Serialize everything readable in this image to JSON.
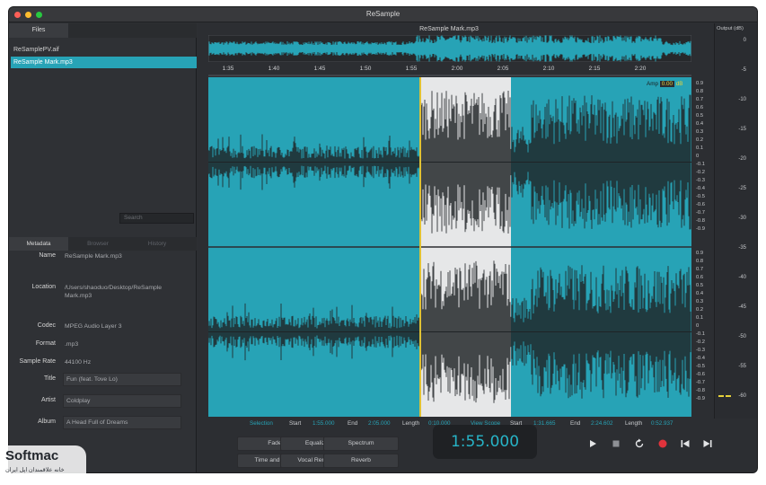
{
  "app": {
    "title": "ReSample"
  },
  "sidebar": {
    "files_tab": "Files",
    "files": [
      "ReSamplePV.aif",
      "ReSample Mark.mp3"
    ],
    "selected_index": 1,
    "search_placeholder": "Search",
    "tabs": [
      "Metadata",
      "Browser",
      "History"
    ],
    "active_tab": 0
  },
  "metadata": {
    "name_label": "Name",
    "name": "ReSample Mark.mp3",
    "location_label": "Location",
    "location": "/Users/shaoduo/Desktop/ReSample Mark.mp3",
    "codec_label": "Codec",
    "codec": "MPEG Audio Layer 3",
    "format_label": "Format",
    "format": ".mp3",
    "sample_rate_label": "Sample Rate",
    "sample_rate": "44100 Hz",
    "title_label": "Title",
    "title": "Fun (feat. Tove Lo)",
    "artist_label": "Artist",
    "artist": "Coldplay",
    "album_label": "Album",
    "album": "A Head Full of Dreams"
  },
  "editor": {
    "filename": "ReSample Mark.mp3",
    "timeline_ticks": [
      "1:35",
      "1:40",
      "1:45",
      "1:50",
      "1:55",
      "2:00",
      "2:05",
      "2:10",
      "2:15",
      "2:20"
    ],
    "amp_label": "Amp",
    "amp_value": "0.00",
    "amp_unit": "dB",
    "amp_scale": [
      "0.9",
      "0.8",
      "0.7",
      "0.6",
      "0.5",
      "0.4",
      "0.3",
      "0.2",
      "0.1",
      "0",
      "-0.1",
      "-0.2",
      "-0.3",
      "-0.4",
      "-0.5",
      "-0.6",
      "-0.7",
      "-0.8",
      "-0.9"
    ],
    "output_label": "Output (dB)",
    "db_scale": [
      "0",
      "-5",
      "-10",
      "-15",
      "-20",
      "-25",
      "-30",
      "-35",
      "-40",
      "-45",
      "-50",
      "-55",
      "-60"
    ],
    "selection": {
      "label": "Selection",
      "start_label": "Start",
      "start": "1:55.000",
      "end_label": "End",
      "end": "2:05.000",
      "length_label": "Length",
      "length": "0:10.000"
    },
    "view_scope": {
      "label": "View Scope",
      "start_label": "Start",
      "start": "1:31.665",
      "end_label": "End",
      "end": "2:24.602",
      "length_label": "Length",
      "length": "0:52.937"
    }
  },
  "effects": [
    "Fade",
    "Equalizer",
    "Spectrum",
    "Time and Pitch",
    "Vocal Removal",
    "Reverb"
  ],
  "transport": {
    "time": "1:55.000"
  },
  "colors": {
    "accent": "#27a3b6",
    "selection_bg": "#e6e7e8",
    "record": "#e0333c"
  },
  "watermark": {
    "brand": "Soft",
    "brand2": "mac",
    "tagline": "خانه علاقمندان اپل ایران"
  }
}
